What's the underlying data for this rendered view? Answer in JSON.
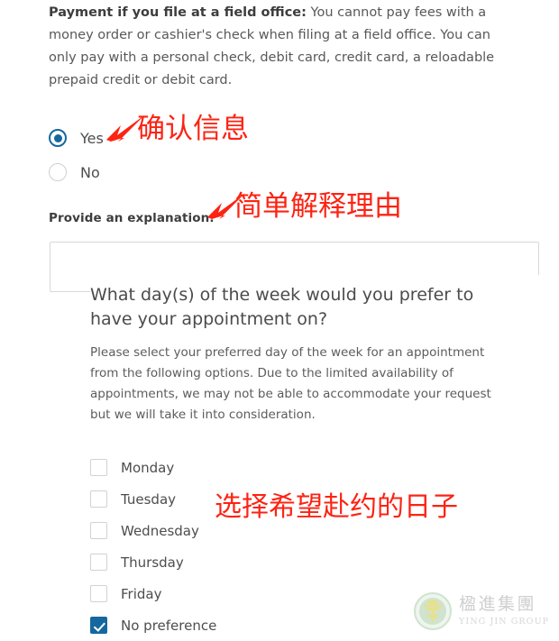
{
  "intro": {
    "bold_lead": "Payment if you file at a field office:",
    "body": " You cannot pay fees with a money order or cashier's check when filing at a field office. You can only pay with a personal check, debit card, credit card, a reloadable prepaid credit or debit card."
  },
  "radio_group": {
    "options": [
      {
        "label": "Yes",
        "selected": true
      },
      {
        "label": "No",
        "selected": false
      }
    ]
  },
  "explanation": {
    "label": "Provide an explanation.",
    "value": "",
    "placeholder": ""
  },
  "appointment": {
    "title": "What day(s) of the week would you prefer to have your appointment on?",
    "description": "Please select your preferred day of the week for an appointment from the following options. Due to the limited availability of appointments, we may not be able to accommodate your request but we will take it into consideration.",
    "options": [
      {
        "label": "Monday",
        "checked": false
      },
      {
        "label": "Tuesday",
        "checked": false
      },
      {
        "label": "Wednesday",
        "checked": false
      },
      {
        "label": "Thursday",
        "checked": false
      },
      {
        "label": "Friday",
        "checked": false
      },
      {
        "label": "No preference",
        "checked": true
      }
    ]
  },
  "annotations": [
    {
      "text": "确认信息"
    },
    {
      "text": "简单解释理由"
    },
    {
      "text": "选择希望赴约的日子"
    }
  ],
  "watermark": {
    "chinese": "楹進集團",
    "english": "YING JIN GROUP"
  },
  "colors": {
    "accent_blue": "#15689e",
    "annotation_red": "#fc2313",
    "border_gray": "#d8d8d8",
    "watermark_green": "#cfe3cf",
    "watermark_gold": "#e8e08a"
  }
}
